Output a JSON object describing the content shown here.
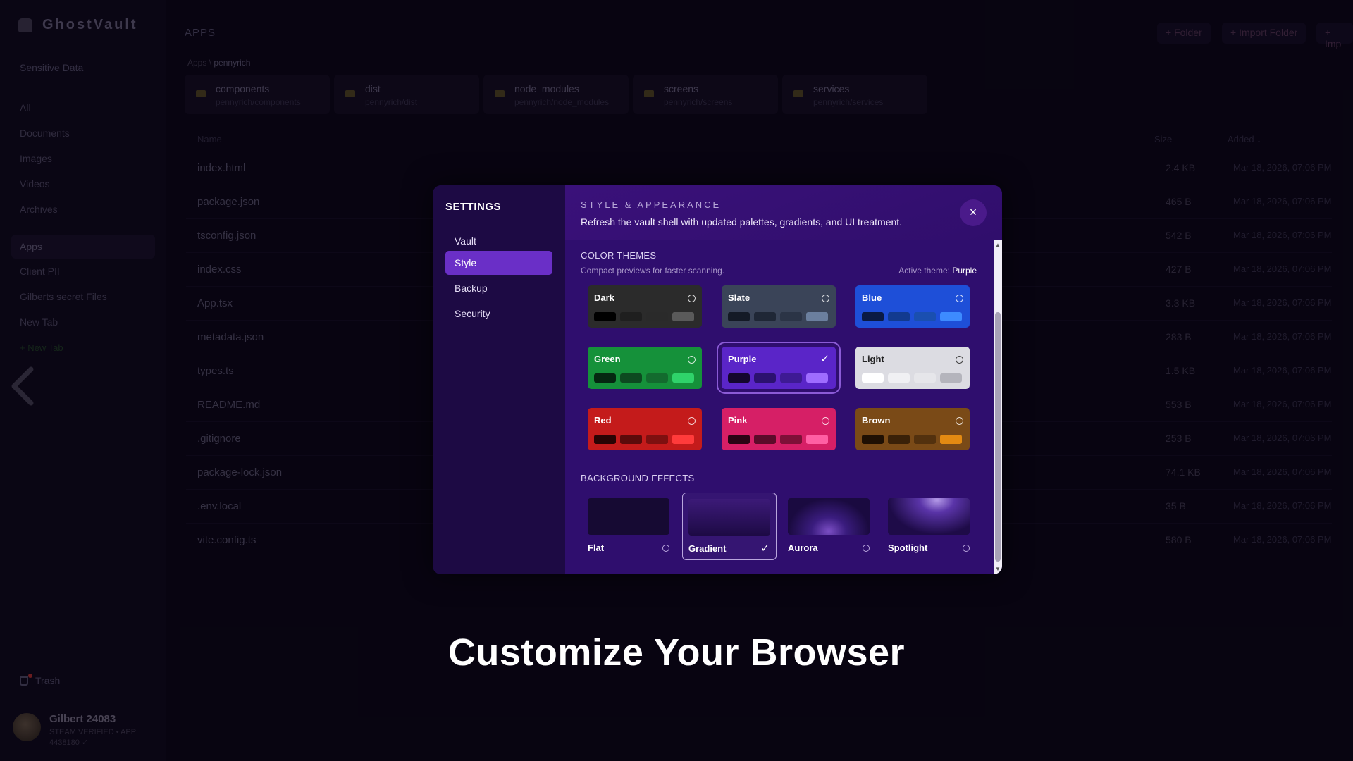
{
  "app": {
    "brand": "GhostVault",
    "sections_label": "Sensitive Data",
    "categories": [
      "All",
      "Documents",
      "Images",
      "Videos",
      "Archives"
    ],
    "vault_tabs": [
      "Apps",
      "Client PII",
      "Gilberts secret Files",
      "New Tab"
    ],
    "new_tab": "+ New Tab",
    "trash": "Trash",
    "user_name": "Gilbert 24083",
    "user_sub_1": "STEAM VERIFIED • APP",
    "user_sub_2": "4438180 ✓"
  },
  "main": {
    "title": "APPS",
    "buttons": [
      "+ Folder",
      "+ Import Folder",
      "+ Imp"
    ],
    "breadcrumb_root": "Apps",
    "breadcrumb_current": "pennyrich",
    "folders": [
      {
        "name": "components",
        "path": "pennyrich/components"
      },
      {
        "name": "dist",
        "path": "pennyrich/dist"
      },
      {
        "name": "node_modules",
        "path": "pennyrich/node_modules"
      },
      {
        "name": "screens",
        "path": "pennyrich/screens"
      },
      {
        "name": "services",
        "path": "pennyrich/services"
      }
    ],
    "columns": {
      "name": "Name",
      "size": "Size",
      "added": "Added ↓"
    },
    "files": [
      {
        "name": "index.html",
        "size": "2.4 KB",
        "date": "Mar 18, 2026, 07:06 PM"
      },
      {
        "name": "package.json",
        "size": "465 B",
        "date": "Mar 18, 2026, 07:06 PM"
      },
      {
        "name": "tsconfig.json",
        "size": "542 B",
        "date": "Mar 18, 2026, 07:06 PM"
      },
      {
        "name": "index.css",
        "size": "427 B",
        "date": "Mar 18, 2026, 07:06 PM"
      },
      {
        "name": "App.tsx",
        "size": "3.3 KB",
        "date": "Mar 18, 2026, 07:06 PM"
      },
      {
        "name": "metadata.json",
        "size": "283 B",
        "date": "Mar 18, 2026, 07:06 PM"
      },
      {
        "name": "types.ts",
        "size": "1.5 KB",
        "date": "Mar 18, 2026, 07:06 PM"
      },
      {
        "name": "README.md",
        "size": "553 B",
        "date": "Mar 18, 2026, 07:06 PM"
      },
      {
        "name": ".gitignore",
        "size": "253 B",
        "date": "Mar 18, 2026, 07:06 PM"
      },
      {
        "name": "package-lock.json",
        "size": "74.1 KB",
        "date": "Mar 18, 2026, 07:06 PM"
      },
      {
        "name": ".env.local",
        "size": "35 B",
        "date": "Mar 18, 2026, 07:06 PM"
      },
      {
        "name": "vite.config.ts",
        "size": "580 B",
        "date": "Mar 18, 2026, 07:06 PM"
      }
    ]
  },
  "settings": {
    "title": "SETTINGS",
    "nav": [
      "Vault",
      "Style",
      "Backup",
      "Security"
    ],
    "active_nav": "Style",
    "kicker": "STYLE & APPEARANCE",
    "description": "Refresh the vault shell with updated palettes, gradients, and UI treatment.",
    "close": "×",
    "themes_title": "COLOR THEMES",
    "themes_sub": "Compact previews for faster scanning.",
    "active_theme_label": "Active theme:",
    "active_theme": "Purple",
    "themes": [
      {
        "name": "Dark",
        "bg": "#2b2b2b",
        "swatches": [
          "#000000",
          "#1f1f1f",
          "#2a2a2a",
          "#5a5a5a"
        ],
        "selected": false
      },
      {
        "name": "Slate",
        "bg": "#3a4458",
        "swatches": [
          "#141a26",
          "#1f2736",
          "#2b3446",
          "#6b7f9e"
        ],
        "selected": false
      },
      {
        "name": "Blue",
        "bg": "#1e4fd8",
        "swatches": [
          "#0a1a44",
          "#123a8f",
          "#1a4fb0",
          "#3d8bff"
        ],
        "selected": false
      },
      {
        "name": "Green",
        "bg": "#15913a",
        "swatches": [
          "#052811",
          "#0d4a20",
          "#136b2e",
          "#2fd36a"
        ],
        "selected": false
      },
      {
        "name": "Purple",
        "bg": "#5a25c8",
        "swatches": [
          "#14062e",
          "#2c1170",
          "#3e1a94",
          "#9f6cff"
        ],
        "selected": true
      },
      {
        "name": "Light",
        "bg": "#dcdce2",
        "swatches": [
          "#ffffff",
          "#f0f0f3",
          "#e6e6ea",
          "#b4b4bc"
        ],
        "selected": false
      },
      {
        "name": "Red",
        "bg": "#c41b1b",
        "swatches": [
          "#2a0404",
          "#5c0b0b",
          "#7e1010",
          "#ff3b3b"
        ],
        "selected": false
      },
      {
        "name": "Pink",
        "bg": "#d61f66",
        "swatches": [
          "#2a0414",
          "#5c0b2a",
          "#7e1038",
          "#ff5fa4"
        ],
        "selected": false
      },
      {
        "name": "Brown",
        "bg": "#7a4a17",
        "swatches": [
          "#1f1003",
          "#3a2108",
          "#53310e",
          "#e38a12"
        ],
        "selected": false
      }
    ],
    "effects_title": "BACKGROUND EFFECTS",
    "effects": [
      {
        "name": "Flat",
        "selected": false
      },
      {
        "name": "Gradient",
        "selected": true
      },
      {
        "name": "Aurora",
        "selected": false
      },
      {
        "name": "Spotlight",
        "selected": false
      }
    ]
  },
  "caption": "Customize Your Browser"
}
